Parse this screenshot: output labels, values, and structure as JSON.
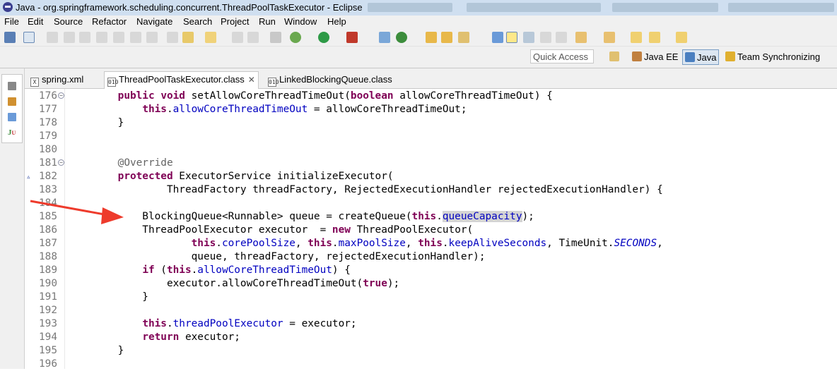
{
  "window": {
    "title": "Java - org.springframework.scheduling.concurrent.ThreadPoolTaskExecutor - Eclipse"
  },
  "menu": [
    "File",
    "Edit",
    "Source",
    "Refactor",
    "Navigate",
    "Search",
    "Project",
    "Run",
    "Window",
    "Help"
  ],
  "perspective_bar": {
    "quick_access_placeholder": "Quick Access",
    "perspectives": [
      {
        "label": "Java EE",
        "active": false
      },
      {
        "label": "Java",
        "active": true
      },
      {
        "label": "Team Synchronizing",
        "active": false
      }
    ]
  },
  "editor_tabs": [
    {
      "label": "spring.xml",
      "icon": "xml-file-icon",
      "active": false
    },
    {
      "label": "ThreadPoolTaskExecutor.class",
      "icon": "class-file-icon",
      "active": true,
      "close": "✕"
    },
    {
      "label": "LinkedBlockingQueue.class",
      "icon": "class-file-icon",
      "active": false
    }
  ],
  "code_lines": [
    {
      "n": "176",
      "fold": "−",
      "html": "    <span class=\"kw\">public</span> <span class=\"kw\">void</span> setAllowCoreThreadTimeOut(<span class=\"kw\">boolean</span> allowCoreThreadTimeOut) {"
    },
    {
      "n": "177",
      "html": "        <span class=\"kw\">this</span>.<span class=\"fld\">allowCoreThreadTimeOut</span> = allowCoreThreadTimeOut;"
    },
    {
      "n": "178",
      "html": "    }"
    },
    {
      "n": "179",
      "html": ""
    },
    {
      "n": "180",
      "html": ""
    },
    {
      "n": "181",
      "fold": "−",
      "html": "    <span class=\"ann\">@Override</span>"
    },
    {
      "n": "182",
      "override": "▵",
      "html": "    <span class=\"kw\">protected</span> ExecutorService initializeExecutor("
    },
    {
      "n": "183",
      "html": "            ThreadFactory threadFactory, RejectedExecutionHandler rejectedExecutionHandler) {"
    },
    {
      "n": "184",
      "html": ""
    },
    {
      "n": "185",
      "html": "        BlockingQueue&lt;Runnable&gt; queue = createQueue(<span class=\"kw\">this</span>.<span class=\"fld hl\">queueCapacity</span>);"
    },
    {
      "n": "186",
      "html": "        ThreadPoolExecutor executor  = <span class=\"kw\">new</span> ThreadPoolExecutor("
    },
    {
      "n": "187",
      "html": "                <span class=\"kw\">this</span>.<span class=\"fld\">corePoolSize</span>, <span class=\"kw\">this</span>.<span class=\"fld\">maxPoolSize</span>, <span class=\"kw\">this</span>.<span class=\"fld\">keepAliveSeconds</span>, TimeUnit.<span class=\"stat\">SECONDS</span>,"
    },
    {
      "n": "188",
      "html": "                queue, threadFactory, rejectedExecutionHandler);"
    },
    {
      "n": "189",
      "html": "        <span class=\"kw\">if</span> (<span class=\"kw\">this</span>.<span class=\"fld\">allowCoreThreadTimeOut</span>) {"
    },
    {
      "n": "190",
      "html": "            executor.allowCoreThreadTimeOut(<span class=\"kw\">true</span>);"
    },
    {
      "n": "191",
      "html": "        }"
    },
    {
      "n": "192",
      "html": ""
    },
    {
      "n": "193",
      "html": "        <span class=\"kw\">this</span>.<span class=\"fld\">threadPoolExecutor</span> = executor;"
    },
    {
      "n": "194",
      "html": "        <span class=\"kw\">return</span> executor;"
    },
    {
      "n": "195",
      "html": "    }"
    },
    {
      "n": "196",
      "html": ""
    }
  ],
  "annotation": {
    "color": "#ee3b2c",
    "icon": "red-arrow-icon"
  }
}
